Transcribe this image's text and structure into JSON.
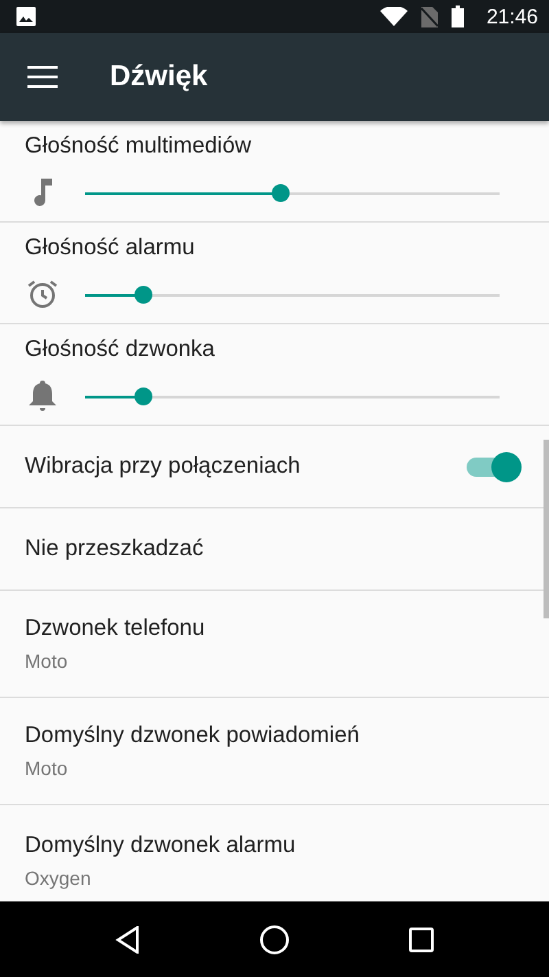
{
  "status_bar": {
    "time": "21:46"
  },
  "app_bar": {
    "title": "Dźwięk"
  },
  "settings": [
    {
      "kind": "slider",
      "label": "Głośność multimediów",
      "level": 0.47
    },
    {
      "kind": "slider",
      "label": "Głośność alarmu",
      "level": 0.14
    },
    {
      "kind": "slider",
      "label": "Głośność dzwonka",
      "level": 0.14
    },
    {
      "kind": "switch",
      "label": "Wibracja przy połączeniach",
      "on": true
    },
    {
      "kind": "plain",
      "label": "Nie przeszkadzać"
    },
    {
      "kind": "plain",
      "label": "Dzwonek telefonu",
      "summary": "Moto"
    },
    {
      "kind": "plain",
      "label": "Domyślny dzwonek powiadomień",
      "summary": "Moto"
    },
    {
      "kind": "plain",
      "label": "Domyślny dzwonek alarmu",
      "summary": "Oxygen"
    }
  ]
}
